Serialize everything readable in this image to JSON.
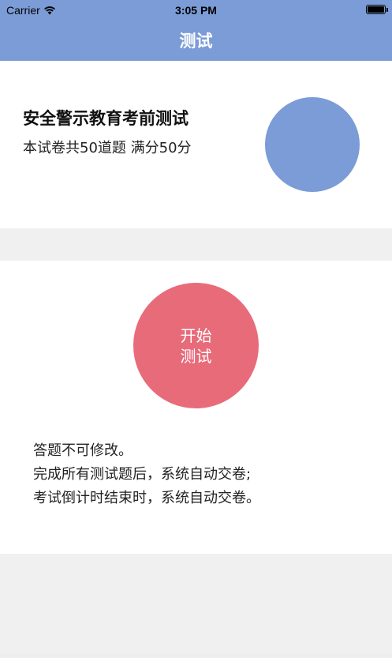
{
  "status_bar": {
    "carrier": "Carrier",
    "time": "3:05 PM",
    "icons": [
      "wifi-icon",
      "battery-icon"
    ]
  },
  "nav": {
    "title": "测试"
  },
  "exam": {
    "title": "安全警示教育考前测试",
    "subtitle": "本试卷共50道题 满分50分"
  },
  "start_button": {
    "line1": "开始",
    "line2": "测试"
  },
  "rules": [
    "答题不可修改。",
    "完成所有测试题后，系统自动交卷;",
    "考试倒计时结束时，系统自动交卷。"
  ],
  "colors": {
    "accent_blue": "#7b9cd6",
    "accent_red": "#e86b7a",
    "background": "#f0f0f0"
  }
}
